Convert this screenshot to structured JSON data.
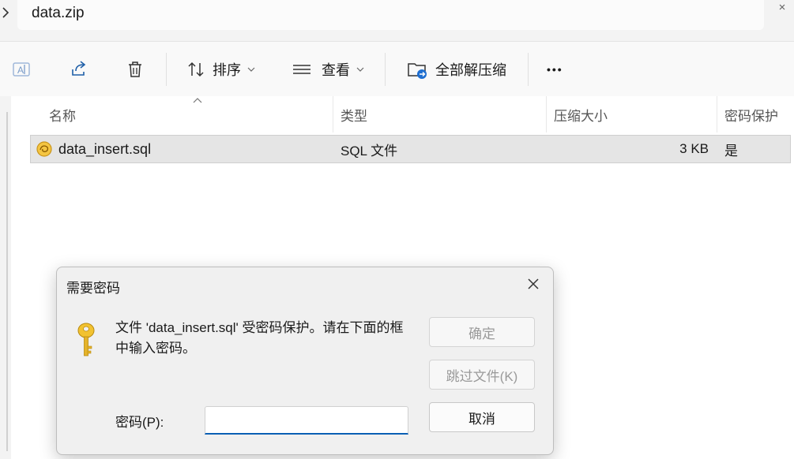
{
  "address": {
    "path": "data.zip"
  },
  "toolbar": {
    "rename_icon": "rename-icon",
    "share_icon": "share-icon",
    "delete_icon": "trash-icon",
    "sort_label": "排序",
    "view_label": "查看",
    "extract_all_label": "全部解压缩",
    "more_label": "•••"
  },
  "columns": {
    "name": "名称",
    "type": "类型",
    "compressed_size": "压缩大小",
    "password_protected": "密码保护"
  },
  "files": [
    {
      "name": "data_insert.sql",
      "type": "SQL 文件",
      "compressed_size": "3 KB",
      "password_protected": "是"
    }
  ],
  "dialog": {
    "title": "需要密码",
    "message": "文件 'data_insert.sql' 受密码保护。请在下面的框中输入密码。",
    "ok_label": "确定",
    "skip_label": "跳过文件(K)",
    "cancel_label": "取消",
    "password_label": "密码(P):",
    "password_value": ""
  },
  "colors": {
    "accent": "#0a5fb4",
    "selection": "#e5e5e5"
  }
}
